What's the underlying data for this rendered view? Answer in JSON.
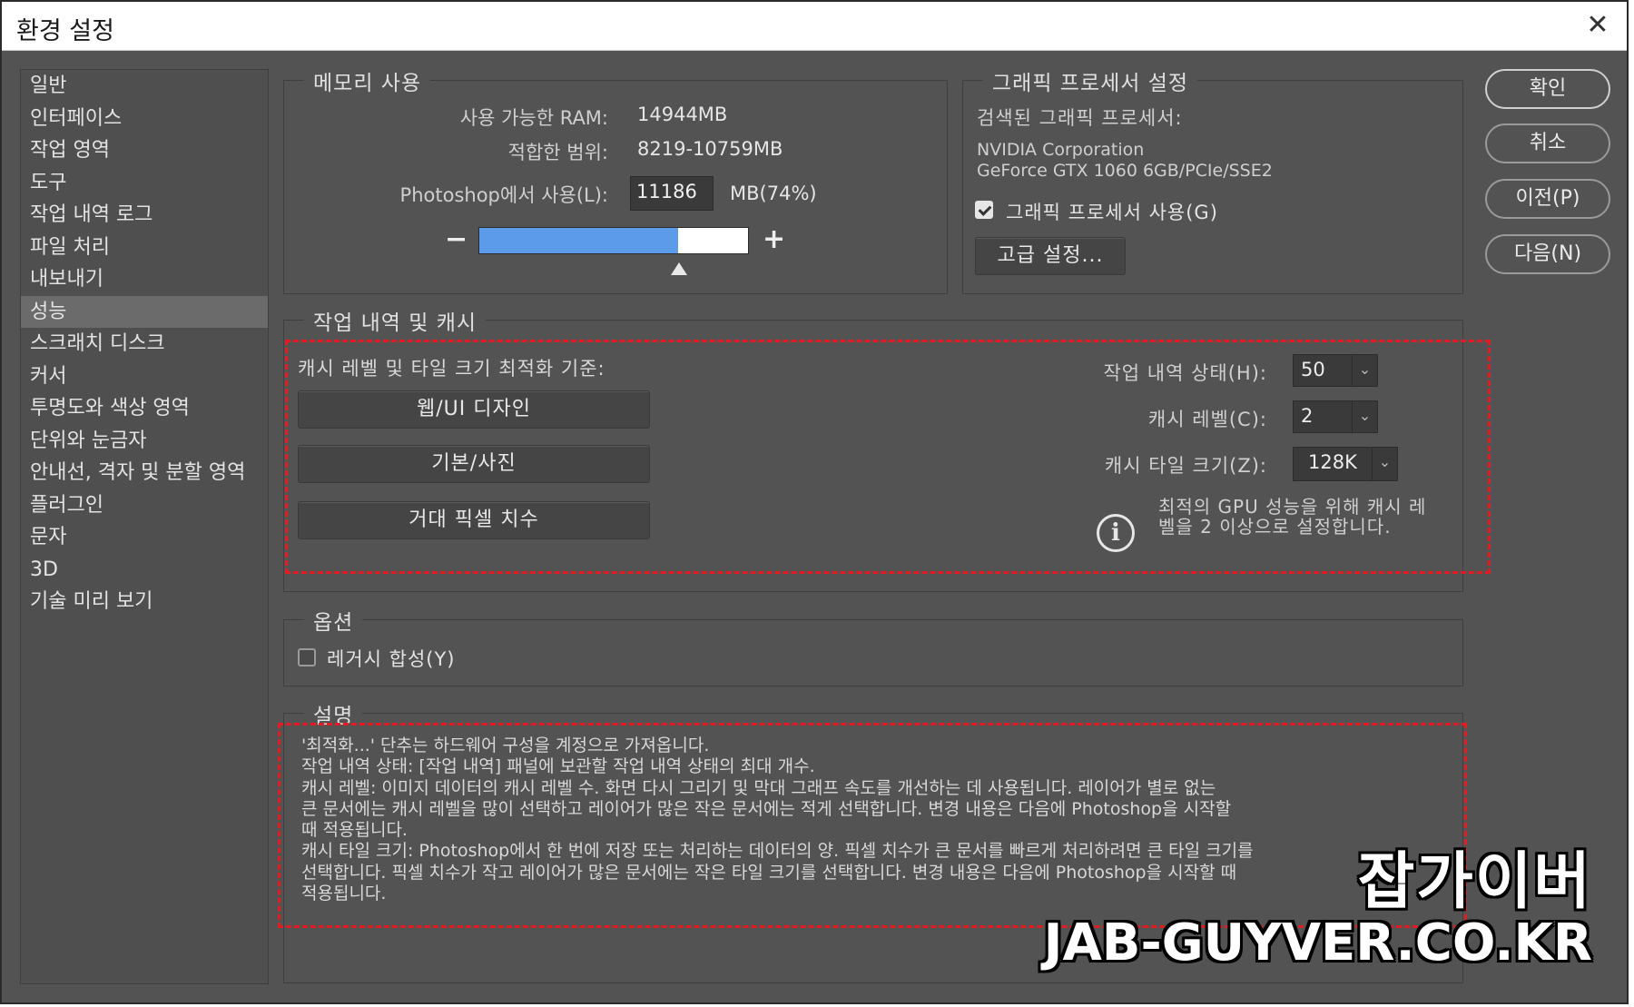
{
  "window": {
    "title": "환경 설정",
    "close_icon": "close-icon"
  },
  "sidebar": {
    "items": [
      {
        "label": "일반"
      },
      {
        "label": "인터페이스"
      },
      {
        "label": "작업 영역"
      },
      {
        "label": "도구"
      },
      {
        "label": "작업 내역 로그"
      },
      {
        "label": "파일 처리"
      },
      {
        "label": "내보내기"
      },
      {
        "label": "성능",
        "selected": true
      },
      {
        "label": "스크래치 디스크"
      },
      {
        "label": "커서"
      },
      {
        "label": "투명도와 색상 영역"
      },
      {
        "label": "단위와 눈금자"
      },
      {
        "label": "안내선, 격자 및 분할 영역"
      },
      {
        "label": "플러그인"
      },
      {
        "label": "문자"
      },
      {
        "label": "3D"
      },
      {
        "label": "기술 미리 보기"
      }
    ]
  },
  "memory": {
    "title": "메모리 사용",
    "available_label": "사용 가능한 RAM:",
    "available_value": "14944MB",
    "range_label": "적합한 범위:",
    "range_value": "8219-10759MB",
    "use_label": "Photoshop에서 사용(L):",
    "use_value": "11186",
    "use_unit": "MB(74%)",
    "slider_fraction": 0.74,
    "minus": "−",
    "plus": "+"
  },
  "gpu": {
    "title": "그래픽 프로세서 설정",
    "detected_label": "검색된 그래픽 프로세서:",
    "vendor": "NVIDIA Corporation",
    "model": "GeForce GTX 1060 6GB/PCIe/SSE2",
    "use_label": "그래픽 프로세서 사용(G)",
    "use_checked": true,
    "advanced_button": "고급 설정..."
  },
  "buttons": {
    "ok": "확인",
    "cancel": "취소",
    "prev": "이전(P)",
    "next": "다음(N)"
  },
  "history": {
    "title": "작업 내역 및 캐시",
    "optimize_label": "캐시 레벨 및 타일 크기 최적화 기준:",
    "preset_web": "웹/UI 디자인",
    "preset_photo": "기본/사진",
    "preset_large": "거대 픽셀 치수",
    "states_label": "작업 내역 상태(H):",
    "states_value": "50",
    "cache_levels_label": "캐시 레벨(C):",
    "cache_levels_value": "2",
    "tile_size_label": "캐시 타일 크기(Z):",
    "tile_size_value": "128K",
    "info_line1": "최적의 GPU 성능을 위해 캐시 레",
    "info_line2": "벨을 2 이상으로 설정합니다."
  },
  "options": {
    "title": "옵션",
    "legacy_label": "레거시 합성(Y)",
    "legacy_checked": false
  },
  "description": {
    "title": "설명",
    "lines": [
      "'최적화...' 단추는 하드웨어 구성을 계정으로 가져옵니다.",
      "작업 내역 상태: [작업 내역] 패널에 보관할 작업 내역 상태의 최대 개수.",
      "캐시 레벨: 이미지 데이터의 캐시 레벨 수. 화면 다시 그리기 및 막대 그래프 속도를 개선하는 데 사용됩니다. 레이어가 별로 없는",
      "큰 문서에는 캐시 레벨을 많이 선택하고 레이어가 많은 작은 문서에는 적게 선택합니다. 변경 내용은 다음에 Photoshop을 시작할",
      "때 적용됩니다.",
      "캐시 타일 크기: Photoshop에서 한 번에 저장 또는 처리하는 데이터의 양. 픽셀 치수가 큰 문서를 빠르게 처리하려면 큰 타일 크기를",
      "선택합니다. 픽셀 치수가 작고 레이어가 많은 문서에는 작은 타일 크기를 선택합니다. 변경 내용은 다음에 Photoshop을 시작할 때",
      "적용됩니다."
    ]
  },
  "watermark": {
    "line1": "잡가이버",
    "line2": "JAB-GUYVER.CO.KR"
  },
  "colors": {
    "dialog_bg": "#535353",
    "slider_fill": "#5b9bea",
    "highlight": "#e31b23"
  }
}
